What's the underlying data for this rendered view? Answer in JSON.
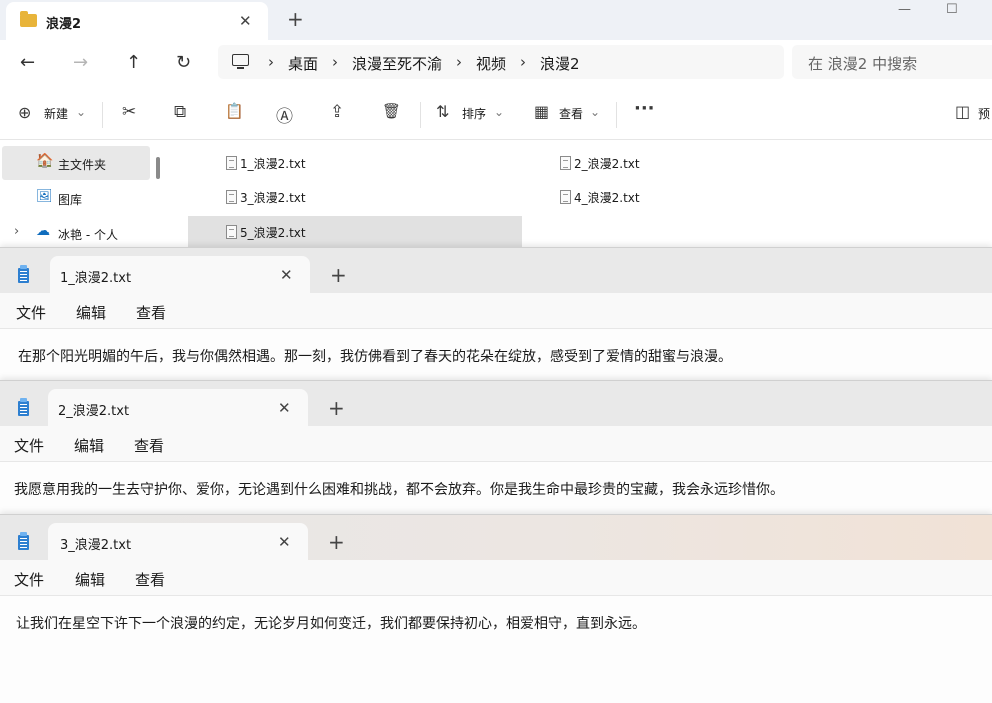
{
  "explorer": {
    "tab_title": "浪漫2",
    "close_glyph": "✕",
    "plus_glyph": "+",
    "window_controls": [
      "—",
      "☐"
    ],
    "nav": {
      "back": "←",
      "forward": "→",
      "up": "↑",
      "refresh": "↻"
    },
    "breadcrumb": [
      "桌面",
      "浪漫至死不渝",
      "视频",
      "浪漫2"
    ],
    "breadcrumb_sep": "›",
    "search_placeholder": "在 浪漫2 中搜索",
    "toolbar": {
      "new_label": "新建",
      "new_icon": "⊕",
      "cut_icon": "✂",
      "copy_icon": "⧉",
      "paste_icon": "📋",
      "rename_icon": "Ⓐ",
      "share_icon": "⇪",
      "delete_icon": "🗑",
      "sort_label": "排序",
      "sort_icon": "⇅",
      "view_label": "查看",
      "view_icon": "▦",
      "chevron": "⌄",
      "more": "···",
      "preview_label": "预",
      "preview_icon": "◫"
    },
    "sidebar": [
      {
        "label": "主文件夹",
        "icon": "🏠"
      },
      {
        "label": "图库",
        "icon": "🖼"
      },
      {
        "label": "冰艳 - 个人",
        "icon": "☁",
        "chevron": "›"
      }
    ],
    "files": [
      "1_浪漫2.txt",
      "2_浪漫2.txt",
      "3_浪漫2.txt",
      "4_浪漫2.txt",
      "5_浪漫2.txt"
    ]
  },
  "notepads": [
    {
      "tab_title": "1_浪漫2.txt",
      "menu": [
        "文件",
        "编辑",
        "查看"
      ],
      "content": "在那个阳光明媚的午后，我与你偶然相遇。那一刻，我仿佛看到了春天的花朵在绽放，感受到了爱情的甜蜜与浪漫。"
    },
    {
      "tab_title": "2_浪漫2.txt",
      "menu": [
        "文件",
        "编辑",
        "查看"
      ],
      "content": "我愿意用我的一生去守护你、爱你，无论遇到什么困难和挑战，都不会放弃。你是我生命中最珍贵的宝藏，我会永远珍惜你。"
    },
    {
      "tab_title": "3_浪漫2.txt",
      "menu": [
        "文件",
        "编辑",
        "查看"
      ],
      "content": "让我们在星空下许下一个浪漫的约定，无论岁月如何变迁，我们都要保持初心，相爱相守，直到永远。"
    }
  ],
  "colors": {
    "folder": "#e8b43a",
    "notepad_icon": "#2d7fd0",
    "onedrive": "#0f6cbd",
    "home": "#e8a33a"
  }
}
